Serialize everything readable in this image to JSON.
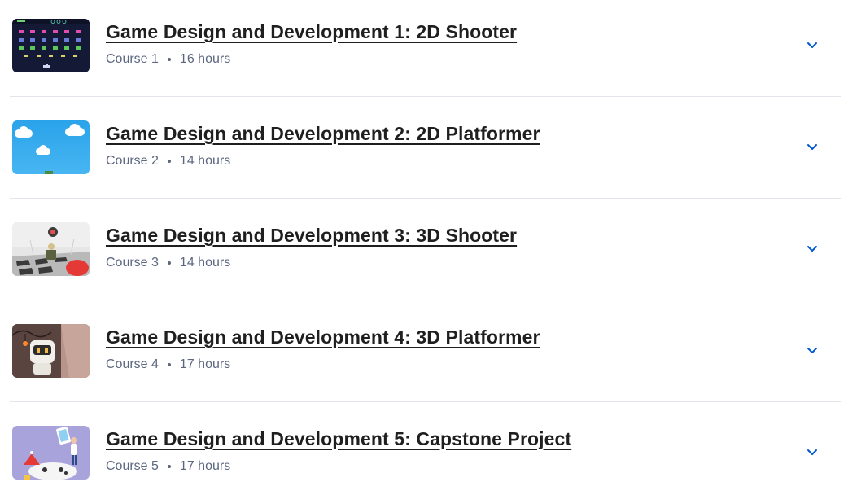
{
  "courses": [
    {
      "title": "Game Design and Development 1: 2D Shooter",
      "course_label": "Course 1",
      "duration": "16 hours",
      "thumbnail_icon": "space-invaders-thumbnail"
    },
    {
      "title": "Game Design and Development 2: 2D Platformer",
      "course_label": "Course 2",
      "duration": "14 hours",
      "thumbnail_icon": "sky-clouds-thumbnail"
    },
    {
      "title": "Game Design and Development 3: 3D Shooter",
      "course_label": "Course 3",
      "duration": "14 hours",
      "thumbnail_icon": "3d-arena-thumbnail"
    },
    {
      "title": "Game Design and Development 4: 3D Platformer",
      "course_label": "Course 4",
      "duration": "17 hours",
      "thumbnail_icon": "robot-character-thumbnail"
    },
    {
      "title": "Game Design and Development 5: Capstone Project",
      "course_label": "Course 5",
      "duration": "17 hours",
      "thumbnail_icon": "gamepad-character-thumbnail"
    }
  ],
  "expand_icon": "chevron-down-icon",
  "colors": {
    "title": "#1f1f1f",
    "meta": "#5b6780",
    "chevron": "#0056d2",
    "divider": "#e1e4ea"
  }
}
